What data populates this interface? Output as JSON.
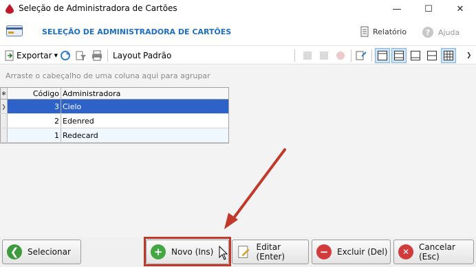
{
  "window": {
    "title": "Seleção de Administradora de Cartões",
    "controls": {
      "minimize": "—",
      "maximize": "☐",
      "close": "✕"
    }
  },
  "header": {
    "title": "SELEÇÃO DE ADMINISTRADORA DE CARTÕES",
    "report_label": "Relatório",
    "help_label": "Ajuda"
  },
  "toolbar": {
    "export_label": "Exportar",
    "layout_label": "Layout",
    "layout_value": "Padrão"
  },
  "grid": {
    "group_hint": "Arraste o cabeçalho de uma coluna aqui para agrupar",
    "columns": {
      "code": "Código",
      "name": "Administradora"
    },
    "rows": [
      {
        "code": "3",
        "name": "Cielo"
      },
      {
        "code": "2",
        "name": "Edenred"
      },
      {
        "code": "1",
        "name": "Redecard"
      }
    ]
  },
  "buttons": {
    "select": "Selecionar",
    "new": "Novo (Ins)",
    "edit": "Editar (Enter)",
    "delete": "Excluir (Del)",
    "cancel": "Cancelar (Esc)"
  },
  "colors": {
    "accent_title": "#1f6ec1",
    "selected_row": "#2d63c8",
    "annotation_red": "#c0392b"
  }
}
